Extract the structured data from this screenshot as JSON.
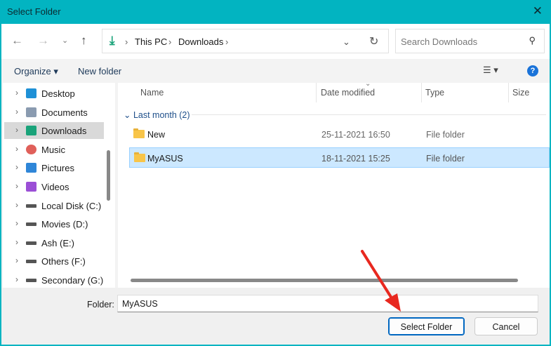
{
  "window": {
    "title": "Select Folder",
    "close": "✕"
  },
  "address": {
    "crumbs": [
      "This PC",
      "Downloads"
    ],
    "search_placeholder": "Search Downloads"
  },
  "toolbar": {
    "organize": "Organize ▾",
    "new_folder": "New folder",
    "help": "?"
  },
  "sidebar": {
    "items": [
      {
        "label": "Desktop",
        "icon": "desktop-icon",
        "color": "#1e90d6"
      },
      {
        "label": "Documents",
        "icon": "documents-icon",
        "color": "#8a9bb0"
      },
      {
        "label": "Downloads",
        "icon": "download-icon",
        "color": "#1aa37a"
      },
      {
        "label": "Music",
        "icon": "music-icon",
        "color": "#e0605a"
      },
      {
        "label": "Pictures",
        "icon": "pictures-icon",
        "color": "#2f86d8"
      },
      {
        "label": "Videos",
        "icon": "videos-icon",
        "color": "#9b4fd6"
      },
      {
        "label": "Local Disk (C:)",
        "icon": "drive-icon",
        "color": "#555"
      },
      {
        "label": "Movies (D:)",
        "icon": "drive-icon",
        "color": "#555"
      },
      {
        "label": "Ash (E:)",
        "icon": "drive-icon",
        "color": "#555"
      },
      {
        "label": "Others (F:)",
        "icon": "drive-icon",
        "color": "#555"
      },
      {
        "label": "Secondary (G:)",
        "icon": "drive-icon",
        "color": "#555"
      }
    ],
    "selected": "Downloads"
  },
  "columns": [
    "Name",
    "Date modified",
    "Type",
    "Size"
  ],
  "group": "Last month (2)",
  "files": [
    {
      "name": "New",
      "date": "25-11-2021 16:50",
      "type": "File folder"
    },
    {
      "name": "MyASUS",
      "date": "18-11-2021 15:25",
      "type": "File folder"
    }
  ],
  "footer": {
    "folder_label": "Folder:",
    "folder_value": "MyASUS",
    "select": "Select Folder",
    "cancel": "Cancel"
  }
}
